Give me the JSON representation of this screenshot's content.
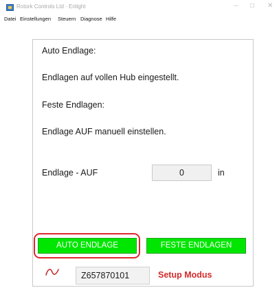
{
  "window": {
    "title": "Rotork Controls Ltd - Enlight",
    "minimize": "–",
    "maximize": "□",
    "close": "✕"
  },
  "menu": {
    "items": [
      "Datei",
      "Einstellungen",
      "Steuern",
      "Diagnose",
      "Hilfe"
    ]
  },
  "main": {
    "auto_heading": "Auto Endlage:",
    "auto_desc": "Endlagen auf vollen Hub eingestellt.",
    "fixed_heading": "Feste Endlagen:",
    "fixed_desc": "Endlage AUF manuell einstellen.",
    "limit_label": "Endlage - AUF",
    "limit_value": "0",
    "limit_unit": "in"
  },
  "buttons": {
    "auto": "AUTO ENDLAGE",
    "fixed": "FESTE ENDLAGEN"
  },
  "footer": {
    "serial": "Z657870101",
    "mode": "Setup Modus",
    "signal_icon": "signal-wave-icon"
  },
  "colors": {
    "button_green": "#00e600",
    "highlight_red": "#e0262e",
    "mode_red": "#d42a2a"
  }
}
